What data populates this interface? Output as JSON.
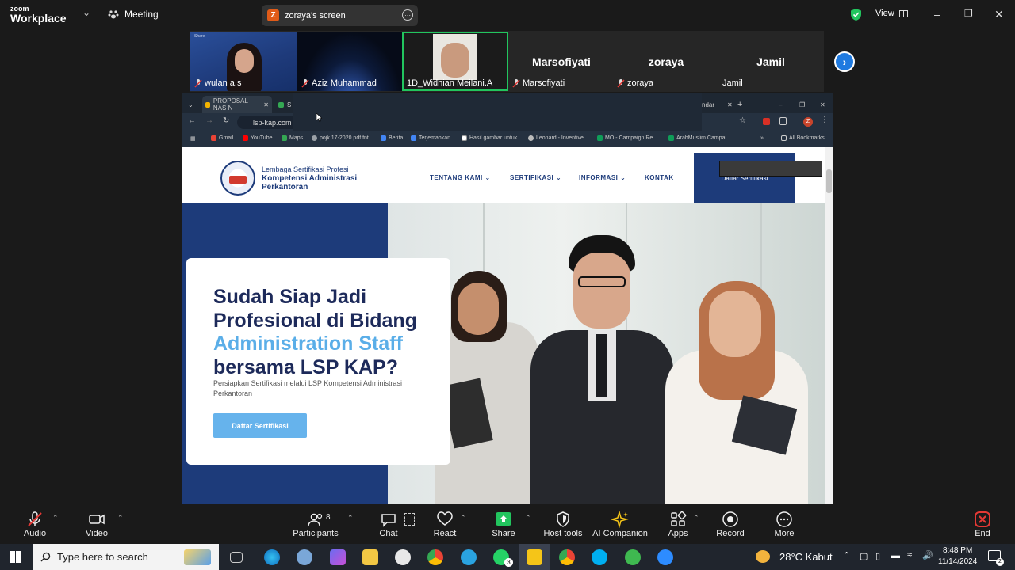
{
  "zoom": {
    "brand_top": "zoom",
    "brand_bottom": "Workplace",
    "meeting_label": "Meeting",
    "share_badge": "Z",
    "share_title": "zoraya's screen",
    "view_label": "View"
  },
  "gallery": {
    "tiles": [
      {
        "name": "wulan a.s",
        "kind": "video"
      },
      {
        "name": "Aziz Muhammad",
        "kind": "video"
      },
      {
        "name": "1D_Widhian Meilani.A",
        "kind": "video"
      },
      {
        "name": "Marsofiyati",
        "kind": "name"
      },
      {
        "name": "zoraya",
        "kind": "name"
      },
      {
        "name": "Jamil",
        "kind": "name"
      }
    ],
    "tile0_tag": "Share"
  },
  "browser": {
    "tab1": "PROPOSAL NAS N",
    "tab2": "S",
    "tab_right": "ndar",
    "url": "lsp-kap.com",
    "bookmarks": [
      "Gmail",
      "YouTube",
      "Maps",
      "pojk 17-2020.pdf.fnt...",
      "Berita",
      "Terjemahkan",
      "Hasil gambar untuk...",
      "Leonard - Inventive...",
      "MO - Campaign Re...",
      "ArahMuslim Campai..."
    ],
    "all_bookmarks": "All Bookmarks",
    "profile": "Z"
  },
  "site": {
    "org_line1": "Lembaga Sertifikasi Profesi",
    "org_line2": "Kompetensi Administrasi",
    "org_line3": "Perkantoran",
    "nav": [
      "TENTANG KAMI",
      "SERTIFIKASI",
      "INFORMASI",
      "KONTAK"
    ],
    "header_cta": "Daftar Sertifikasi",
    "headline1": "Sudah Siap Jadi",
    "headline2": "Profesional di Bidang",
    "headline3": "Administration Staff",
    "headline4": "bersama LSP KAP?",
    "subtext": "Persiapkan Sertifikasi melalui LSP Kompetensi Administrasi Perkantoran",
    "cta": "Daftar Sertifikasi",
    "accent_navy": "#1d3b7a",
    "accent_blue": "#5aaee8"
  },
  "controls": {
    "audio": "Audio",
    "video": "Video",
    "participants": "Participants",
    "participants_count": "8",
    "chat": "Chat",
    "react": "React",
    "share": "Share",
    "host_tools": "Host tools",
    "ai": "AI Companion",
    "apps": "Apps",
    "record": "Record",
    "more": "More",
    "end": "End"
  },
  "taskbar": {
    "search_placeholder": "Type here to search",
    "weather": "28°C  Kabut",
    "time": "8:48 PM",
    "date": "11/14/2024",
    "whatsapp_badge": "3",
    "notif": "2"
  }
}
